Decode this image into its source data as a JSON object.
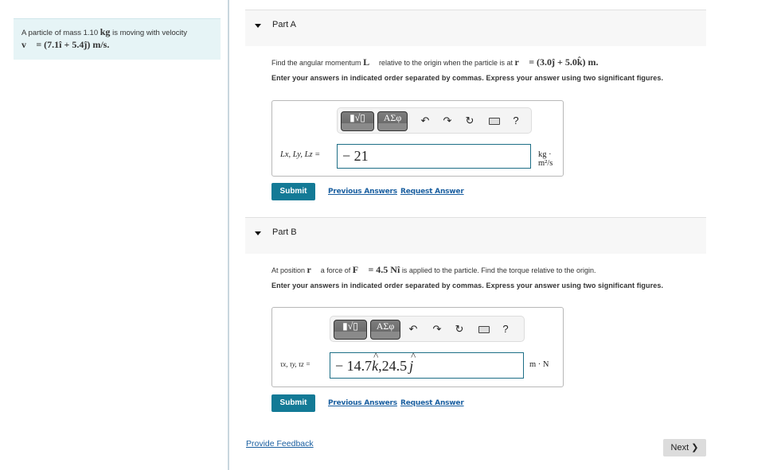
{
  "problem": {
    "intro_text": "A particle of mass 1.10",
    "mass_unit": "kg",
    "intro_tail": "is moving with velocity",
    "velocity_expr": "v⃗ = (7.1î + 5.4ĵ) m/s."
  },
  "parts": [
    {
      "title": "Part A",
      "prompt_prefix": "Find the angular momentum",
      "prompt_symbol": "L⃗",
      "prompt_middle": "relative to the origin when the particle is at",
      "prompt_expr": "r⃗ = (3.0ĵ + 5.0k̂) m.",
      "instructions": "Enter your answers in indicated order separated by commas. Express your answer using two significant figures.",
      "input_label": "Lx, Ly, Lz =",
      "input_value": "− 21",
      "unit": "kg · m²/s",
      "submit_label": "Submit",
      "previous_answers_label": "Previous Answers",
      "request_answer_label": "Request Answer"
    },
    {
      "title": "Part B",
      "prompt_prefix": "At position",
      "prompt_symbol": "r⃗",
      "prompt_middle": "a force of",
      "prompt_expr": "F⃗ = 4.5 Nî",
      "prompt_tail": "is applied to the particle. Find the torque relative to the origin.",
      "instructions": "Enter your answers in indicated order separated by commas. Express your answer using two significant figures.",
      "input_label": "τx, τy, τz =",
      "input_value_parts": [
        "− 14.7",
        "k",
        ",24.5",
        "j"
      ],
      "unit": "m · N",
      "submit_label": "Submit",
      "previous_answers_label": "Previous Answers",
      "request_answer_label": "Request Answer"
    }
  ],
  "toolbar": {
    "templates_label": "▮√▯",
    "symbols_label": "ΑΣφ",
    "undo_icon": "undo-icon",
    "redo_icon": "redo-icon",
    "reset_icon": "reset-icon",
    "keyboard_icon": "keyboard-icon",
    "help_label": "?"
  },
  "footer": {
    "feedback_label": "Provide Feedback",
    "next_label": "Next ❯"
  }
}
